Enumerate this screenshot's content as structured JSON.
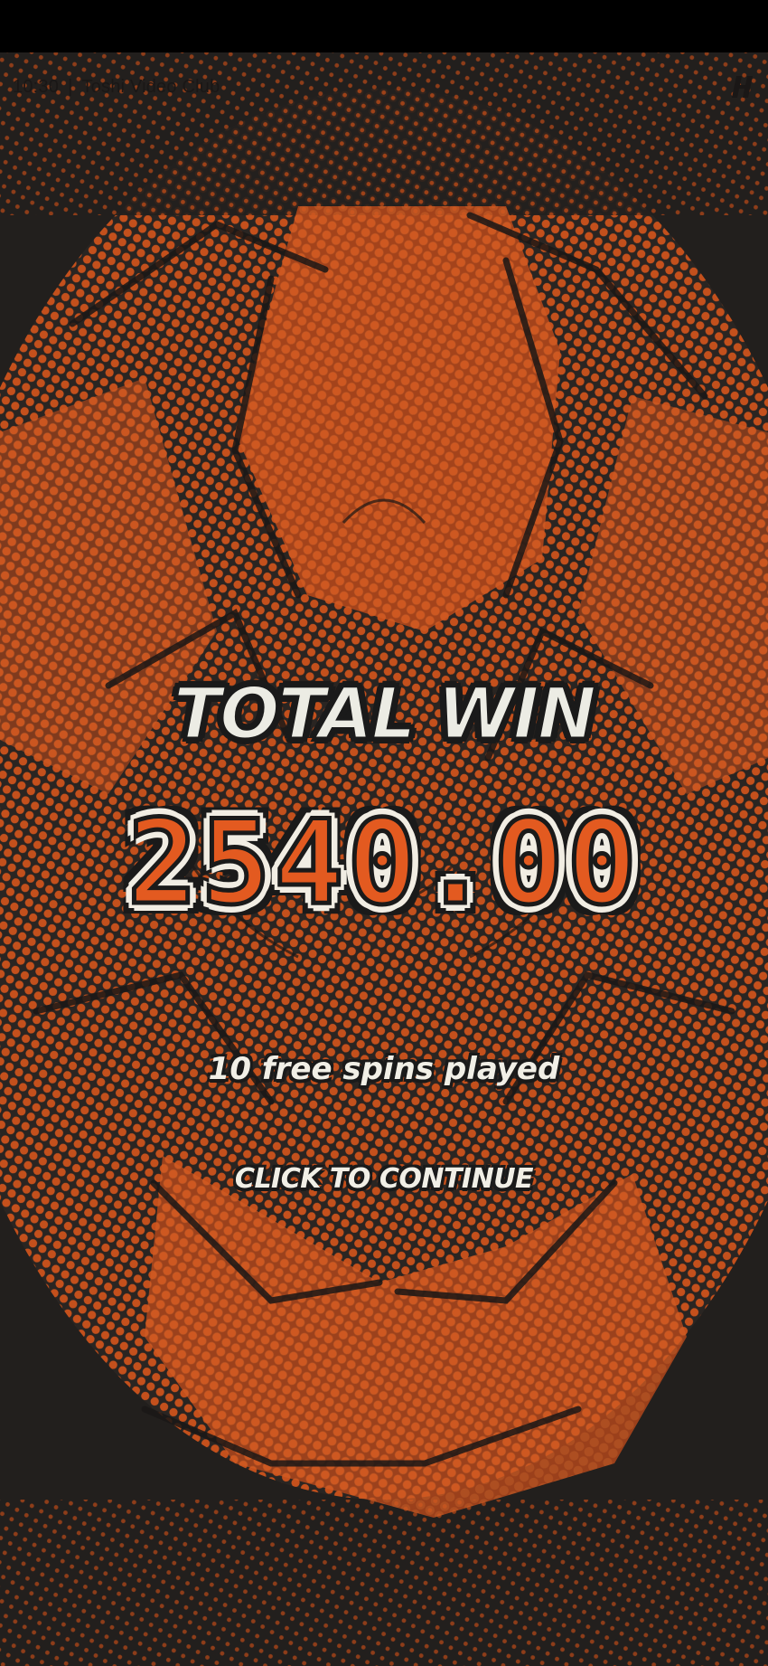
{
  "status_bar": {
    "time": "10:30",
    "separator": "|",
    "title": "Toshi Video Club",
    "logo_icon": "toshi-logo-icon"
  },
  "win_screen": {
    "label": "TOTAL WIN",
    "amount": "2540.00",
    "spins_text": "10 free spins played",
    "continue_label": "CLICK TO CONTINUE"
  },
  "colors": {
    "background_dark": "#221f1d",
    "artwork_orange": "#c4501c",
    "amount_orange": "#e35a20",
    "text_cream": "#f1efe6",
    "outline": "#1a1a1a"
  }
}
